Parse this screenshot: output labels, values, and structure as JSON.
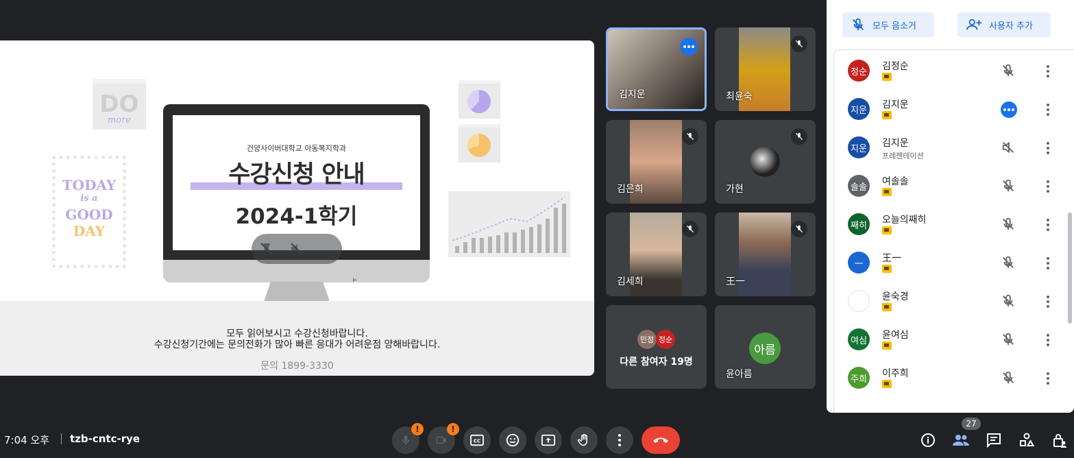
{
  "presentation": {
    "todo_big": "DO",
    "todo_small": "more",
    "today_lines": [
      "TODAY",
      "is a",
      "GOOD",
      "DAY"
    ],
    "screen_subtitle": "건양사이버대학교 아동복지학과",
    "screen_title": "수강신청 안내",
    "screen_year": "2024-1학기",
    "notes_line1": "모두 읽어보시고 수강신청바랍니다.",
    "notes_line2": "수강신청기간에는 문의전화가 많아 빠른 응대가 어려운점 양해바랍니다.",
    "contact": "문의 1899-3330"
  },
  "tiles": [
    {
      "name": "김지운"
    },
    {
      "name": "최윤숙"
    },
    {
      "name": "김은희"
    },
    {
      "name": "가현"
    },
    {
      "name": "김세희"
    },
    {
      "name": "王一"
    }
  ],
  "others_tile": {
    "label": "다른 참여자 19명",
    "avatars": [
      "민정",
      "정순"
    ]
  },
  "ahreum_tile": {
    "name": "윤아름",
    "avatar": "아름"
  },
  "panel": {
    "mute_all": "모두 음소거",
    "add_user": "사용자 추가",
    "participants": [
      {
        "avatar": "정순",
        "name": "김정순",
        "color": "#c5221f"
      },
      {
        "avatar": "지운",
        "name": "김지운",
        "color": "#174ea6"
      },
      {
        "avatar": "지운",
        "name": "김지운",
        "sub": "프레젠테이션",
        "color": "#174ea6"
      },
      {
        "avatar": "솔솔",
        "name": "여솔솔",
        "color": "#5f6368"
      },
      {
        "avatar": "째히",
        "name": "오늘의째히",
        "color": "#0d652d"
      },
      {
        "avatar": "一",
        "name": "王一",
        "color": "#1967d2"
      },
      {
        "avatar": "",
        "name": "윤숙경",
        "color": "#ffffff"
      },
      {
        "avatar": "여심",
        "name": "윤여심",
        "color": "#137333"
      },
      {
        "avatar": "주희",
        "name": "이주희",
        "color": "#4d9c2e"
      }
    ]
  },
  "bottom": {
    "time": "7:04 오후",
    "meeting_code": "tzb-cntc-rye",
    "participant_count": "27",
    "warn": "!"
  },
  "colors": {
    "accent": "#8ab4f8",
    "end_call": "#ea4335",
    "panel_button": "#e8f0fe"
  }
}
